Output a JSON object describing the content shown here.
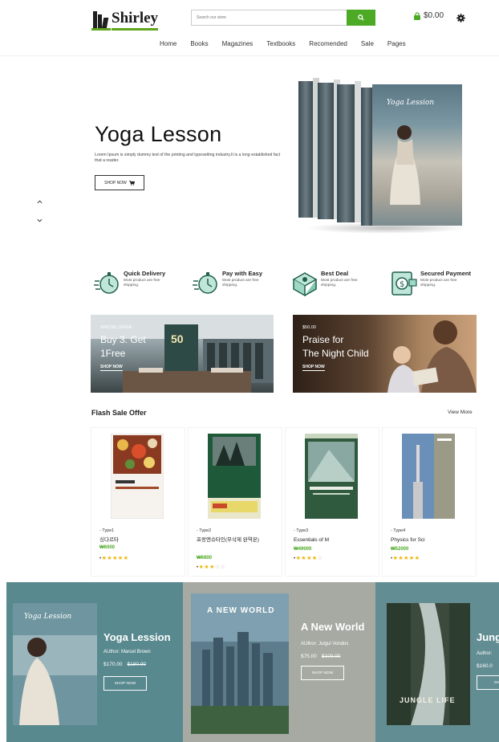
{
  "header": {
    "logo_text": "Shirley",
    "search_placeholder": "Search our store",
    "cart_total": "$0.00",
    "nav": [
      "Home",
      "Books",
      "Magazines",
      "Textbooks",
      "Recomended",
      "Sale",
      "Pages"
    ]
  },
  "hero": {
    "title": "Yoga Lesson",
    "description": "Lorem Ipsum is simply dummy text of the printing and typesetting industry.It is a long established fact that a reader.",
    "button": "SHOP NOW",
    "book_title": "Yoga Lession"
  },
  "features": [
    {
      "title": "Quick Delivery",
      "desc": "Most product are free shipping."
    },
    {
      "title": "Pay with Easy",
      "desc": "Most product are free shipping."
    },
    {
      "title": "Best Deal",
      "desc": "Most product are free shipping."
    },
    {
      "title": "Secured Payment",
      "desc": "Most product are free shipping."
    }
  ],
  "promos": [
    {
      "kicker": "SPECIAL OFFER",
      "line1": "Buy 3. Get",
      "line2": "1Free",
      "button": "SHOP NOW",
      "sign": "50"
    },
    {
      "kicker": "$50.00",
      "line1": "Praise for",
      "line2": "The Night Child",
      "button": "SHOP NOW"
    }
  ],
  "flash_sale": {
    "title": "Flash Sale Offer",
    "view_more": "View More",
    "products": [
      {
        "type": "- Type1",
        "name": "싱다르타",
        "price": "₩6000",
        "rating": 5
      },
      {
        "type": "- Type2",
        "name": "프랑엔슈타인(무삭제 완역본)",
        "price": "₩6800",
        "rating": 3
      },
      {
        "type": "- Type3",
        "name": "Essentials of M",
        "price": "₩49000",
        "rating": 4
      },
      {
        "type": "- Type4",
        "name": "Physics for Sci",
        "price": "₩52000",
        "rating": 5
      }
    ]
  },
  "carousel": [
    {
      "title": "Yoga Lession",
      "author": "AUthor: Marcel Brown",
      "price": "$170.00",
      "old_price": "$180.00",
      "button": "SHOP NOW",
      "cover_title": "Yoga Lession"
    },
    {
      "title": "A New World",
      "author": "AUthor: Julgul Vondos",
      "price": "$75.00",
      "old_price": "$100.00",
      "button": "SHOP NOW",
      "cover_title": "A NEW WORLD"
    },
    {
      "title": "Jung",
      "author": "Author:",
      "price": "$160.0",
      "button": "SHO",
      "cover_title": "JUNGLE LIFE"
    }
  ],
  "colors": {
    "accent": "#4caa24",
    "star": "#f0b400",
    "carousel_bg": "#4f7e86"
  }
}
